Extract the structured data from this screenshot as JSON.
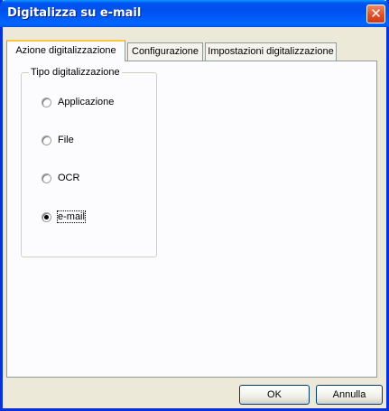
{
  "window": {
    "title": "Digitalizza su e-mail",
    "close_glyph": "✕"
  },
  "tabs": [
    {
      "label": "Azione digitalizzazione",
      "active": true
    },
    {
      "label": "Configurazione",
      "active": false
    },
    {
      "label": "Impostazioni digitalizzazione",
      "active": false
    }
  ],
  "group": {
    "label": "Tipo digitalizzazione",
    "options": [
      {
        "label": "Applicazione",
        "selected": false
      },
      {
        "label": "File",
        "selected": false
      },
      {
        "label": "OCR",
        "selected": false
      },
      {
        "label": "e-mail",
        "selected": true
      }
    ]
  },
  "buttons": {
    "ok_label": "OK",
    "cancel_label": "Annulla"
  },
  "colors": {
    "title_bar": "#0054e3",
    "close_button": "#e0512a",
    "window_bg": "#ece9d8",
    "active_tab_accent": "#ffc83c"
  }
}
